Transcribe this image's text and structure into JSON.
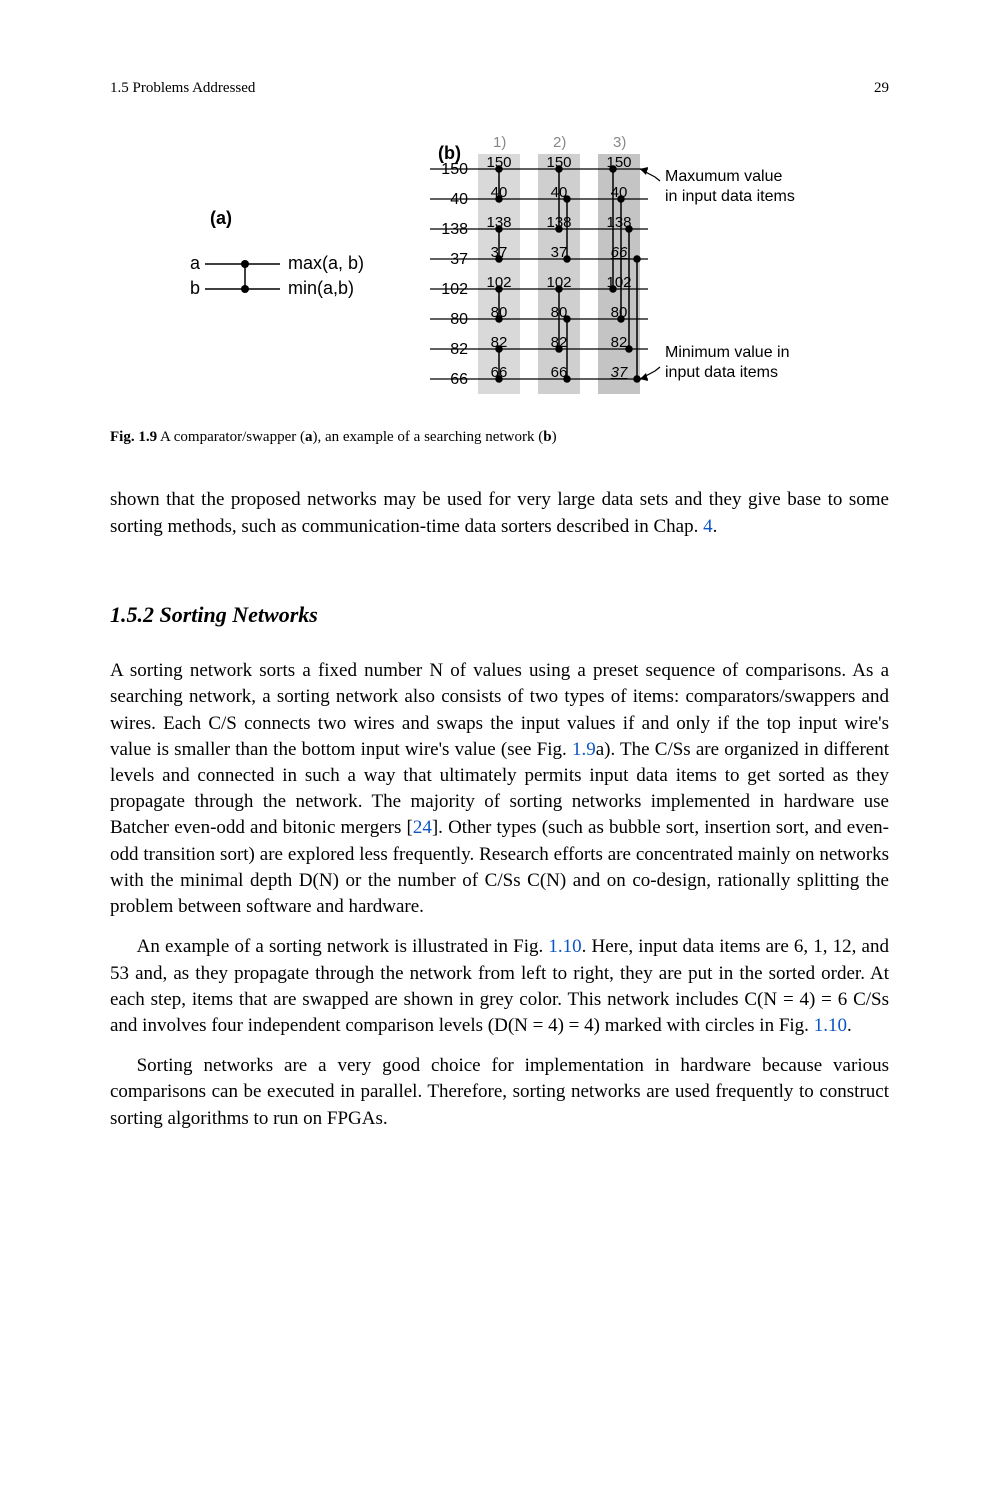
{
  "header": {
    "section_label": "1.5  Problems Addressed",
    "page_number": "29"
  },
  "figure_1_9": {
    "panel_a": {
      "label": "(a)",
      "input_top": "a",
      "input_bottom": "b",
      "output_top": "max(a, b)",
      "output_bottom": "min(a,b)"
    },
    "panel_b": {
      "label": "(b)",
      "phase_labels": [
        "1)",
        "2)",
        "3)"
      ],
      "left_values": [
        "150",
        "40",
        "138",
        "37",
        "102",
        "80",
        "82",
        "66"
      ],
      "col1": [
        "150",
        "40",
        "138",
        "37",
        "102",
        "80",
        "82",
        "66"
      ],
      "col2": [
        "150",
        "40",
        "138",
        "37",
        "102",
        "80",
        "82",
        "66"
      ],
      "col3": [
        "150",
        "40",
        "138",
        "66",
        "102",
        "80",
        "82",
        "37"
      ],
      "annotation_top": "Maxumum value in input data items",
      "annotation_bottom": "Minimum value in input data items"
    },
    "caption_prefix": "Fig. 1.9",
    "caption_text_1": "  A comparator/swapper (",
    "caption_bold_a": "a",
    "caption_text_2": "), an example of a searching network (",
    "caption_bold_b": "b",
    "caption_text_3": ")"
  },
  "paragraphs": {
    "lead_in": "shown that the proposed networks may be used for very large data sets and they give base to some sorting methods, such as communication-time data sorters described in Chap. ",
    "lead_in_link": "4",
    "lead_in_tail": ".",
    "heading_number": "1.5.2",
    "heading_title": "   Sorting Networks",
    "p2_a": "A sorting network sorts a fixed number N of values using a preset sequence of comparisons. As a searching network, a sorting network also consists of two types of items: comparators/swappers and wires. Each C/S connects two wires and swaps the input values if and only if the top input wire's value is smaller than the bottom input wire's value (see Fig. ",
    "p2_link1": "1.9",
    "p2_b": "a). The C/Ss are organized in different levels and connected in such a way that ultimately permits input data items to get sorted as they propagate through the network. The majority of sorting networks implemented in hardware use Batcher even-odd and bitonic mergers [",
    "p2_link2": "24",
    "p2_c": "]. Other types (such as bubble sort, insertion sort, and even-odd transition sort) are explored less frequently. Research efforts are concentrated mainly on networks with the minimal depth D(N) or the number of C/Ss C(N) and on co-design, rationally splitting the problem between software and hardware.",
    "p3_a": "An example of a sorting network is illustrated in Fig. ",
    "p3_link1": "1.10",
    "p3_b": ". Here, input data items are 6, 1, 12, and 53 and, as they propagate through the network from left to right, they are put in the sorted order. At each step, items that are swapped are shown in grey color. This network includes C(N = 4) = 6 C/Ss and involves four independent comparison levels (D(N = 4) = 4) marked with circles in Fig. ",
    "p3_link2": "1.10",
    "p3_c": ".",
    "p4": "Sorting networks are a very good choice for implementation in hardware because various comparisons can be executed in parallel. Therefore, sorting networks are used frequently to construct sorting algorithms to run on FPGAs."
  }
}
